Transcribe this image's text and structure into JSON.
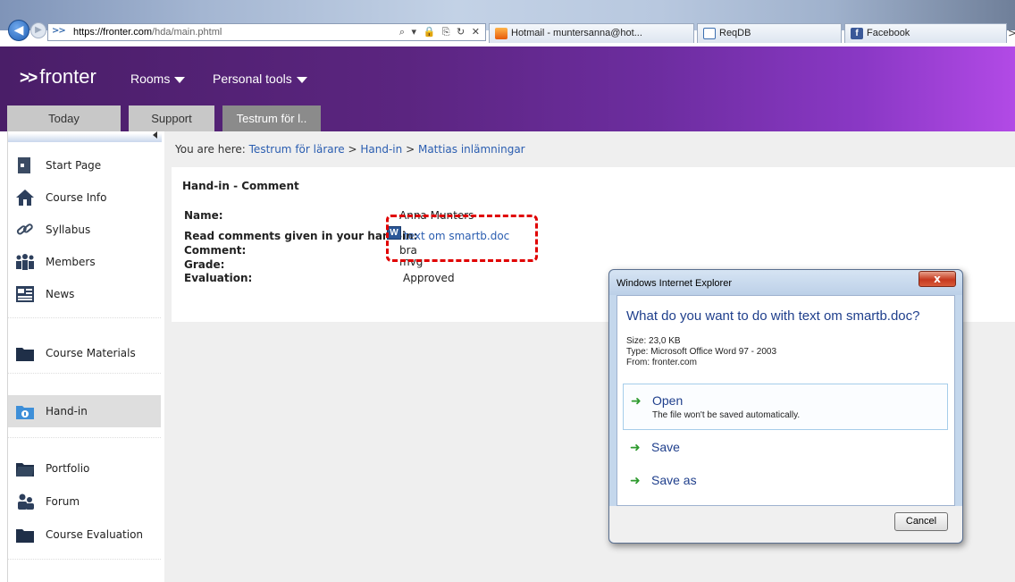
{
  "browser": {
    "address_url_host": "https://fronter.com",
    "address_url_path": "/hda/main.phtml",
    "address_icons": "⌕ ▾ 🔒 ⎘ ↻ ✕",
    "tabs": [
      {
        "label": "Hotmail - muntersanna@hot...",
        "icon": "hotmail-icon"
      },
      {
        "label": "ReqDB",
        "icon": "reqdb-icon"
      },
      {
        "label": "Facebook",
        "icon": "facebook-icon"
      }
    ],
    "more": ">"
  },
  "fronter": {
    "logo_arrows": ">>",
    "logo_text": "fronter",
    "menus": [
      "Rooms",
      "Personal tools"
    ],
    "room_tabs": [
      "Today",
      "Support",
      "Testrum för l.."
    ]
  },
  "sidebar": {
    "items": [
      {
        "label": "Start Page",
        "icon": "start-page-icon"
      },
      {
        "label": "Course Info",
        "icon": "home-icon"
      },
      {
        "label": "Syllabus",
        "icon": "link-icon"
      },
      {
        "label": "Members",
        "icon": "members-icon"
      },
      {
        "label": "News",
        "icon": "news-icon"
      },
      {
        "label": "Course Materials",
        "icon": "folder-icon"
      },
      {
        "label": "Hand-in",
        "icon": "handin-folder-icon"
      },
      {
        "label": "Portfolio",
        "icon": "portfolio-folder-icon"
      },
      {
        "label": "Forum",
        "icon": "forum-icon"
      },
      {
        "label": "Course Evaluation",
        "icon": "folder-icon"
      }
    ]
  },
  "content": {
    "breadcrumb_prefix": "You are here:",
    "breadcrumb": [
      "Testrum för lärare",
      "Hand-in",
      "Mattias inlämningar"
    ],
    "breadcrumb_sep": ">",
    "title": "Hand-in - Comment",
    "rows": [
      {
        "label": "Name:",
        "value": "Anna Munters"
      },
      {
        "label": "Read comments given in your hand-in:",
        "value": "text om smartb.doc"
      },
      {
        "label": "Comment:",
        "value": "bra"
      },
      {
        "label": "Grade:",
        "value": "mvg"
      },
      {
        "label": "Evaluation:",
        "value": "Approved"
      }
    ],
    "word_icon_letter": "W"
  },
  "dialog": {
    "title": "Windows Internet Explorer",
    "close_label": "x",
    "question": "What do you want to do with text om smartb.doc?",
    "size": "Size: 23,0 KB",
    "type": "Type: Microsoft Office Word 97 - 2003",
    "from": "From: fronter.com",
    "options": [
      {
        "label": "Open",
        "sub": "The file won't be saved automatically."
      },
      {
        "label": "Save",
        "sub": ""
      },
      {
        "label": "Save as",
        "sub": ""
      }
    ],
    "arrow": "➜",
    "cancel_label": "Cancel"
  },
  "colors": {
    "header_purple": "#5b2580",
    "link_blue": "#2a5db0",
    "annotation_red": "#e00000",
    "dialog_blue": "#1f3f8c",
    "option_arrow_green": "#2e9a2e"
  }
}
